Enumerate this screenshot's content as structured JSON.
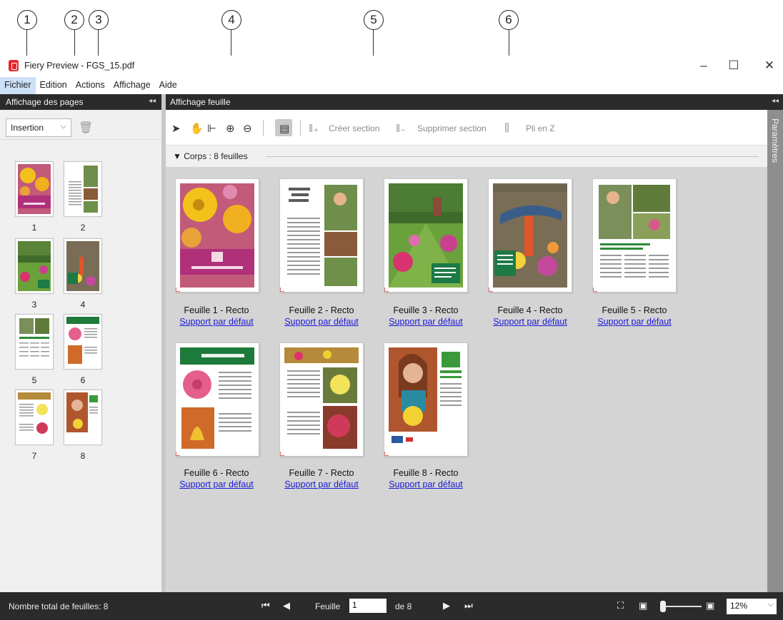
{
  "callouts": [
    "1",
    "2",
    "3",
    "4",
    "5",
    "6"
  ],
  "window": {
    "title": "Fiery Preview - FGS_15.pdf",
    "minimize": "–",
    "maximize": "☐",
    "close": "✕"
  },
  "menu": [
    "Fichier",
    "Edition",
    "Actions",
    "Affichage",
    "Aide"
  ],
  "left_panel": {
    "title": "Affichage des pages",
    "mode_select": "Insertion",
    "pages": [
      "1",
      "2",
      "3",
      "4",
      "5",
      "6",
      "7",
      "8"
    ]
  },
  "main_panel": {
    "title": "Affichage feuille",
    "toolbar": {
      "create_section": "Créer section",
      "delete_section": "Supprimer section",
      "z_fold": "Pli en Z"
    },
    "section_label": "Corps : 8 feuilles",
    "sheets": [
      {
        "label": "Feuille 1 - Recto",
        "media": "Support par défaut"
      },
      {
        "label": "Feuille 2 - Recto",
        "media": "Support par défaut"
      },
      {
        "label": "Feuille 3 - Recto",
        "media": "Support par défaut"
      },
      {
        "label": "Feuille 4 - Recto",
        "media": "Support par défaut"
      },
      {
        "label": "Feuille 5 - Recto",
        "media": "Support par défaut"
      },
      {
        "label": "Feuille 6 - Recto",
        "media": "Support par défaut"
      },
      {
        "label": "Feuille 7 - Recto",
        "media": "Support par défaut"
      },
      {
        "label": "Feuille 8 - Recto",
        "media": "Support par défaut"
      }
    ]
  },
  "right_panel": {
    "title": "Paramètres"
  },
  "status": {
    "total": "Nombre total de feuilles: 8",
    "sheet_label": "Feuille",
    "sheet_value": "1",
    "of": "de 8",
    "zoom": "12%"
  },
  "colors": {
    "dark_bar": "#2b2b2b",
    "canvas": "#d4d4d4",
    "link": "#1a1ad6",
    "accent_red": "#e8262c"
  }
}
